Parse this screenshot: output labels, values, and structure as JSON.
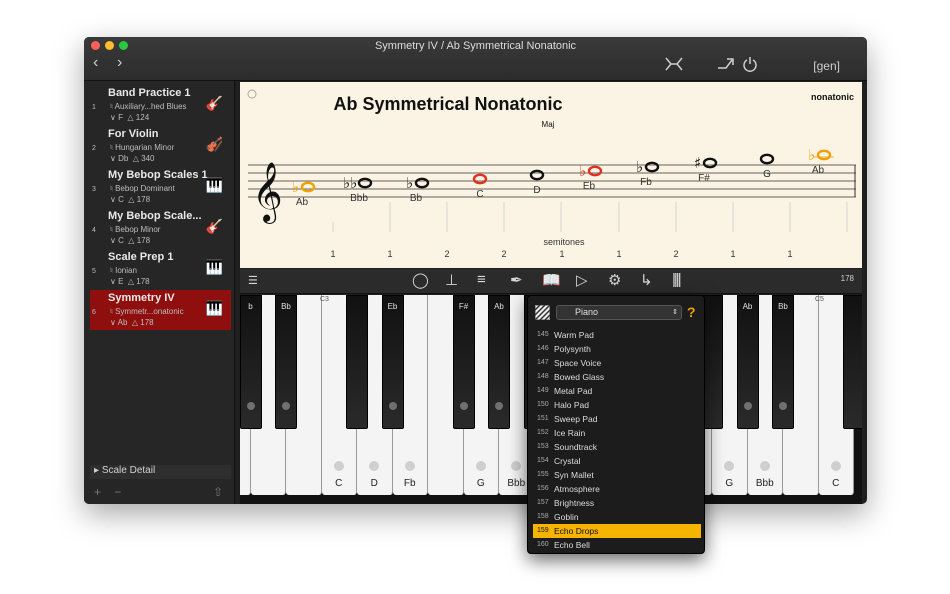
{
  "window": {
    "title": "Symmetry IV / Ab Symmetrical Nonatonic",
    "colors": {
      "close": "#ff5f57",
      "minimize": "#febc2e",
      "maximize": "#28c840"
    },
    "gen_label": "[gen]",
    "icons": [
      "back-arrow-icon",
      "forward-arrow-icon",
      "collapse-icon",
      "share-arrow-icon",
      "power-icon"
    ]
  },
  "sidebar": {
    "items": [
      {
        "num": "1",
        "title": "Band Practice 1",
        "sub": "Auxiliary...hed Blues",
        "key": "F",
        "tempo": "124",
        "icon": "guitar-icon"
      },
      {
        "num": "2",
        "title": "For Violin",
        "sub": "Hungarian Minor",
        "key": "Db",
        "tempo": "340",
        "icon": "violin-icon"
      },
      {
        "num": "3",
        "title": "My Bebop Scales 1",
        "sub": "Bebop Dominant",
        "key": "C",
        "tempo": "178",
        "icon": "piano-icon"
      },
      {
        "num": "4",
        "title": "My Bebop Scale...",
        "sub": "Bebop Minor",
        "key": "C",
        "tempo": "178",
        "icon": "guitar-icon"
      },
      {
        "num": "5",
        "title": "Scale Prep 1",
        "sub": "Ionian",
        "key": "E",
        "tempo": "178",
        "icon": "piano-icon"
      },
      {
        "num": "6",
        "title": "Symmetry IV",
        "sub": "Symmetr...onatonic",
        "key": "Ab",
        "tempo": "178",
        "icon": "piano-icon"
      }
    ],
    "selected_index": 5,
    "scale_detail": "Scale Detail",
    "selection_color": "#8f0f0f"
  },
  "score": {
    "title": "Ab Symmetrical Nonatonic",
    "subtitle": "Maj",
    "scale_name": "nonatonic",
    "note_labels": [
      "Ab",
      "Bbb",
      "Bb",
      "C",
      "D",
      "Eb",
      "Fb",
      "F#",
      "G",
      "Ab"
    ],
    "semitones_label": "semitones",
    "semitones": [
      "1",
      "1",
      "2",
      "2",
      "1",
      "1",
      "2",
      "1",
      "1"
    ],
    "colors": {
      "root": "#f0a000",
      "accent": "#e03020",
      "note": "#111111"
    }
  },
  "toolbar": {
    "icons": [
      "staff-lines-icon",
      "loop-icon",
      "tuning-fork-icon",
      "list-icon",
      "pen-icon",
      "book-icon",
      "play-icon",
      "gear-icon",
      "repeat-arrow-icon",
      "bars-icon"
    ],
    "tempo": "178"
  },
  "keyboard": {
    "white_labels": [
      "",
      "",
      "",
      "C",
      "D",
      "Fb",
      "",
      "G",
      "Bbb",
      "",
      "",
      "",
      "",
      "",
      "G",
      "Bbb",
      "",
      "C",
      ""
    ],
    "black_labels": [
      "b",
      "Bb",
      "Eb",
      "F#",
      "Ab",
      "Bb",
      "Ab",
      "Bb"
    ],
    "octave_labels": [
      "C3",
      "C5"
    ]
  },
  "instrument_popup": {
    "instrument": "Piano",
    "help": "?",
    "items": [
      {
        "num": "145",
        "label": "Warm Pad"
      },
      {
        "num": "146",
        "label": "Polysynth"
      },
      {
        "num": "147",
        "label": "Space Voice"
      },
      {
        "num": "148",
        "label": "Bowed Glass"
      },
      {
        "num": "149",
        "label": "Metal Pad"
      },
      {
        "num": "150",
        "label": "Halo Pad"
      },
      {
        "num": "151",
        "label": "Sweep Pad"
      },
      {
        "num": "152",
        "label": "Ice Rain"
      },
      {
        "num": "153",
        "label": "Soundtrack"
      },
      {
        "num": "154",
        "label": "Crystal"
      },
      {
        "num": "155",
        "label": "Syn Mallet"
      },
      {
        "num": "156",
        "label": "Atmosphere"
      },
      {
        "num": "157",
        "label": "Brightness"
      },
      {
        "num": "158",
        "label": "Goblin"
      },
      {
        "num": "159",
        "label": "Echo Drops"
      },
      {
        "num": "160",
        "label": "Echo Bell"
      }
    ],
    "selected_index": 14,
    "selection_color": "#f5b400"
  }
}
